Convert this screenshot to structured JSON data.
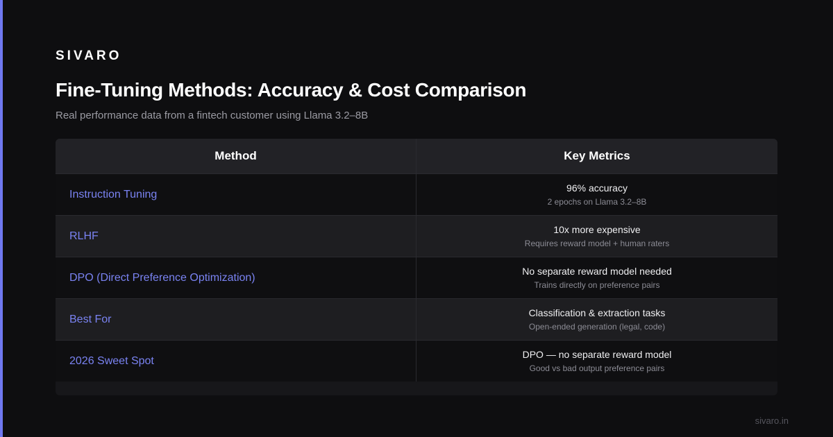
{
  "brand": "SIVARO",
  "title": "Fine-Tuning Methods: Accuracy & Cost Comparison",
  "subtitle": "Real performance data from a fintech customer using Llama 3.2–8B",
  "table": {
    "headers": [
      "Method",
      "Key Metrics"
    ],
    "rows": [
      {
        "method": "Instruction Tuning",
        "metric": "96% accuracy",
        "detail": "2 epochs on Llama 3.2–8B"
      },
      {
        "method": "RLHF",
        "metric": "10x more expensive",
        "detail": "Requires reward model + human raters"
      },
      {
        "method": "DPO (Direct Preference Optimization)",
        "metric": "No separate reward model needed",
        "detail": "Trains directly on preference pairs"
      },
      {
        "method": "Best For",
        "metric": "Classification & extraction tasks",
        "detail": "Open-ended generation (legal, code)"
      },
      {
        "method": "2026 Sweet Spot",
        "metric": "DPO — no separate reward model",
        "detail": "Good vs bad output preference pairs"
      }
    ]
  },
  "footer": "sivaro.in",
  "colors": {
    "accent": "#6f78f0",
    "background": "#0e0e10",
    "method_text": "#7a83f2"
  }
}
